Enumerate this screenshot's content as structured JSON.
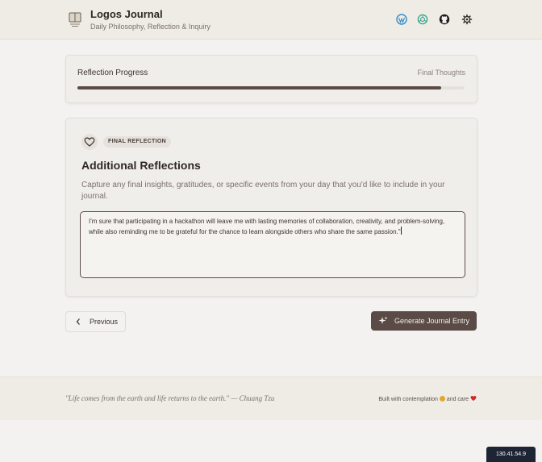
{
  "header": {
    "title": "Logos Journal",
    "subtitle": "Daily Philosophy, Reflection & Inquiry",
    "icons": [
      "wordpress-icon",
      "openai-icon",
      "github-icon",
      "settings-icon"
    ]
  },
  "progress": {
    "label": "Reflection Progress",
    "step_label": "Final Thoughts",
    "fraction": 0.94
  },
  "section": {
    "badge": "FINAL REFLECTION",
    "title": "Additional Reflections",
    "description": "Capture any final insights, gratitudes, or specific events from your day that you'd like to include in your journal.",
    "entry_text": "I'm sure that participating in a hackathon will leave me with lasting memories of collaboration, creativity, and problem-solving, while also reminding me to be grateful for the chance to learn alongside others who share the same passion.\""
  },
  "nav": {
    "previous_label": "Previous",
    "generate_label": "Generate Journal Entry"
  },
  "footer": {
    "quote": "\"Life comes from the earth and life returns to the earth.\" — Chuang Tzu",
    "credit_prefix": "Built with contemplation",
    "credit_and": "and care"
  },
  "ip_label": "130.41.54.9",
  "colors": {
    "accent": "#5a4b47",
    "background": "#f3f2f0",
    "header_bg": "#efebe5",
    "wordpress": "#2d8fc8",
    "openai": "#2fa58c"
  }
}
